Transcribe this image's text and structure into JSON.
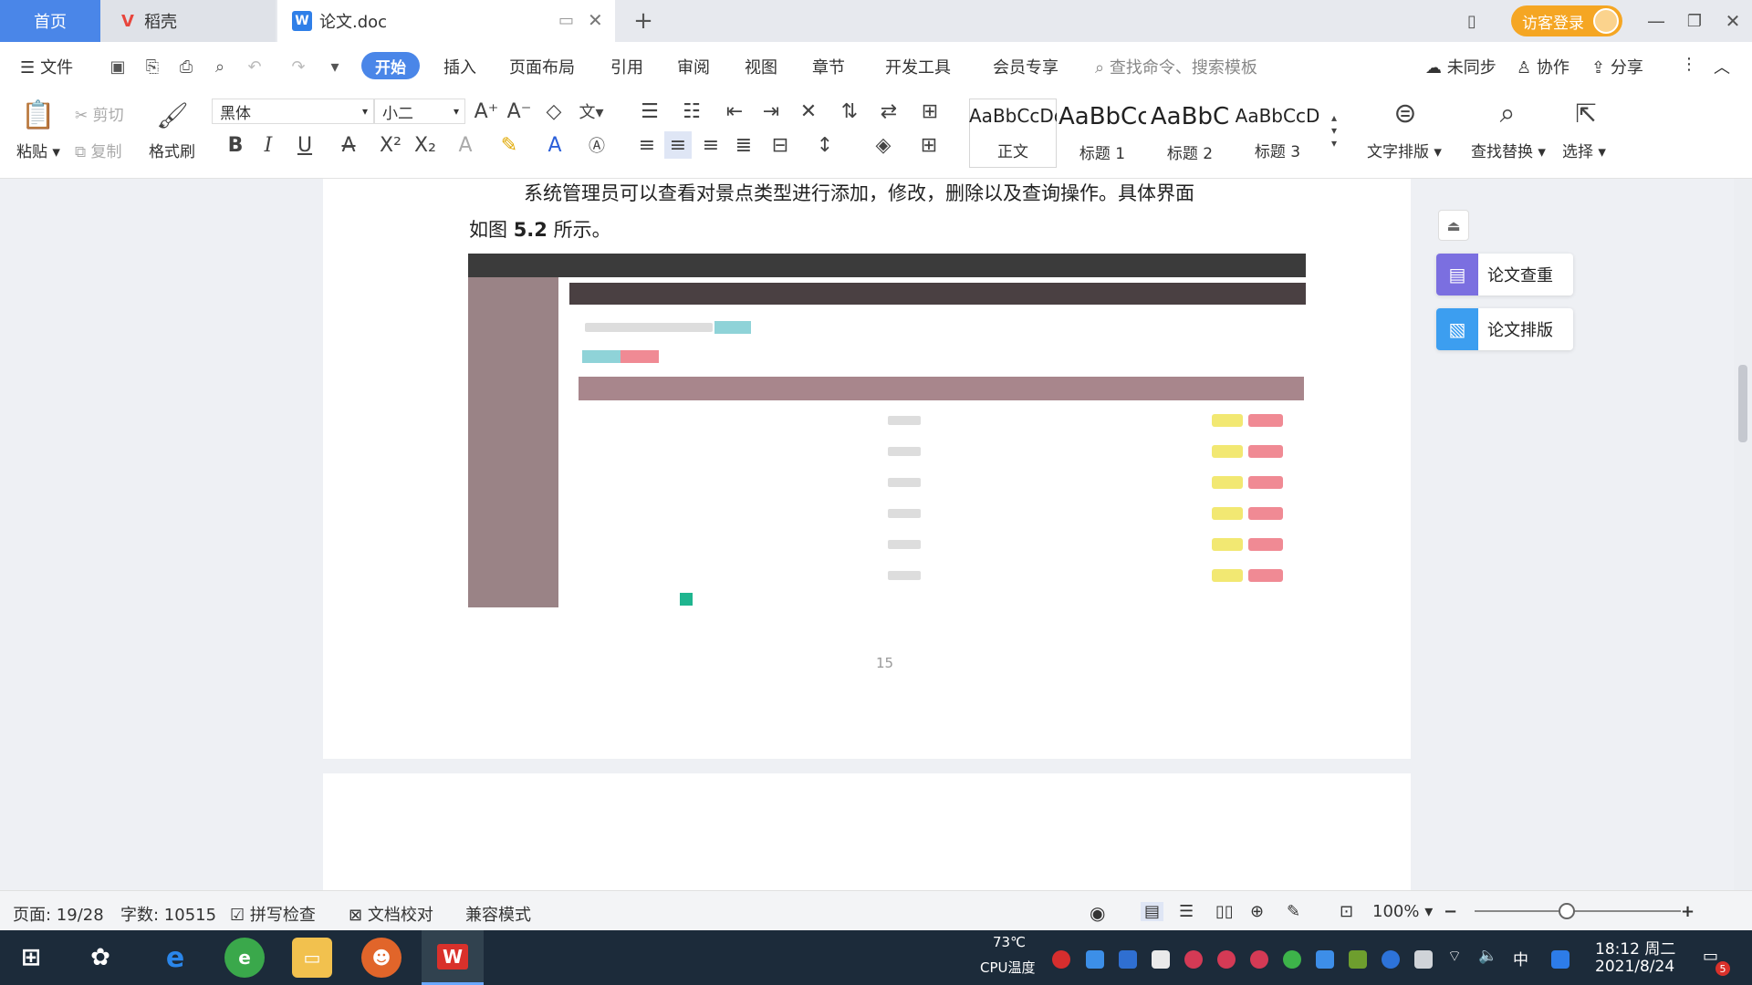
{
  "titlebar": {
    "tabs": [
      {
        "label": "首页"
      },
      {
        "label": "稻壳"
      },
      {
        "label": "论文.doc"
      }
    ],
    "login_label": "访客登录"
  },
  "menubar": {
    "file_label": "文件",
    "items": [
      "开始",
      "插入",
      "页面布局",
      "引用",
      "审阅",
      "视图",
      "章节",
      "开发工具",
      "会员专享"
    ],
    "search_placeholder": "查找命令、搜索模板",
    "sync_label": "未同步",
    "collab_label": "协作",
    "share_label": "分享"
  },
  "ribbon": {
    "paste": "粘贴",
    "cut": "剪切",
    "copy": "复制",
    "format_painter": "格式刷",
    "font_name": "黑体",
    "font_size": "小二",
    "styles": [
      {
        "sample": "AaBbCcDd",
        "name": "正文"
      },
      {
        "sample": "AaBbCc",
        "name": "标题 1"
      },
      {
        "sample": "AaBbC",
        "name": "标题 2"
      },
      {
        "sample": "AaBbCcD",
        "name": "标题 3"
      }
    ],
    "text_layout": "文字排版",
    "find_replace": "查找替换",
    "select": "选择"
  },
  "document": {
    "paragraph_line1": "系统管理员可以查看对景点类型进行添加，修改，删除以及查询操作。具体界面",
    "paragraph_line2_prefix": "如图 ",
    "figure_ref": "5.2",
    "paragraph_line2_suffix": " 所示。",
    "page_number": "15"
  },
  "side_panel": {
    "check_label": "论文查重",
    "layout_label": "论文排版"
  },
  "statusbar": {
    "page": "页面: 19/28",
    "words": "字数: 10515",
    "spellcheck": "拼写检查",
    "proofread": "文档校对",
    "compat": "兼容模式",
    "zoom": "100%"
  },
  "taskbar": {
    "cpu_temp": "73℃",
    "cpu_label": "CPU温度",
    "ime": "中",
    "time": "18:12 周二",
    "date": "2021/8/24",
    "notification_count": "5"
  },
  "colors": {
    "accent": "#4a86e8",
    "login": "#f5a623",
    "taskbar": "#1c2b3a"
  }
}
